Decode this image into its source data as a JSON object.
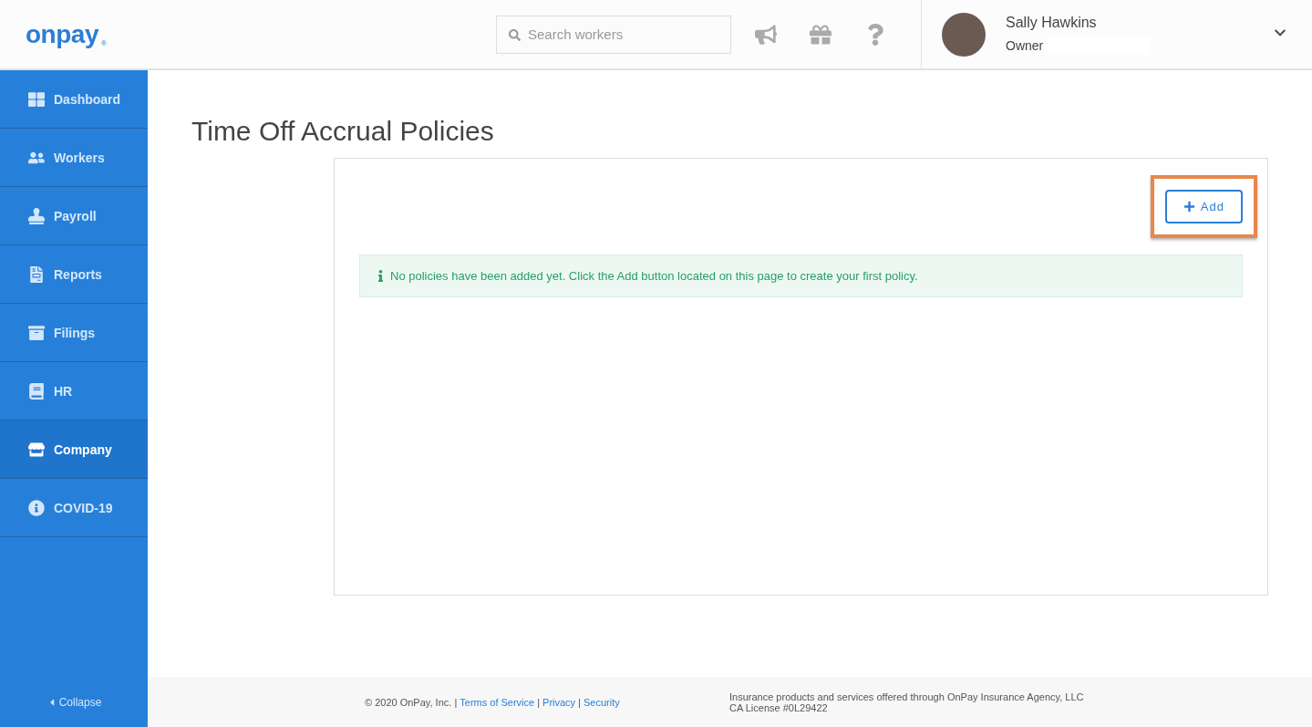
{
  "header": {
    "logo": "onpay",
    "logo_mark": "®",
    "search": {
      "placeholder": "Search workers"
    },
    "user": {
      "name": "Sally Hawkins",
      "role": "Owner"
    }
  },
  "sidebar": {
    "items": [
      {
        "label": "Dashboard",
        "kind": "dashboard",
        "selected": false
      },
      {
        "label": "Workers",
        "kind": "workers",
        "selected": false
      },
      {
        "label": "Payroll",
        "kind": "payroll",
        "selected": false
      },
      {
        "label": "Reports",
        "kind": "reports",
        "selected": false
      },
      {
        "label": "Filings",
        "kind": "filings",
        "selected": false
      },
      {
        "label": "HR",
        "kind": "hr",
        "selected": false
      },
      {
        "label": "Company",
        "kind": "company",
        "selected": true
      },
      {
        "label": "COVID-19",
        "kind": "covid",
        "selected": false
      }
    ],
    "collapse": "Collapse"
  },
  "page": {
    "title": "Time Off Accrual Policies",
    "add_button": "Add",
    "notice": "No policies have been added yet. Click the Add button located on this page to create your first policy."
  },
  "footer": {
    "copyright": "© 2020 OnPay, Inc. |",
    "separator": "|",
    "links": [
      "Terms of Service",
      "Privacy",
      "Security"
    ],
    "insurance": "Insurance products and services offered through OnPay Insurance Agency, LLC",
    "license": "CA License #0L29422"
  }
}
